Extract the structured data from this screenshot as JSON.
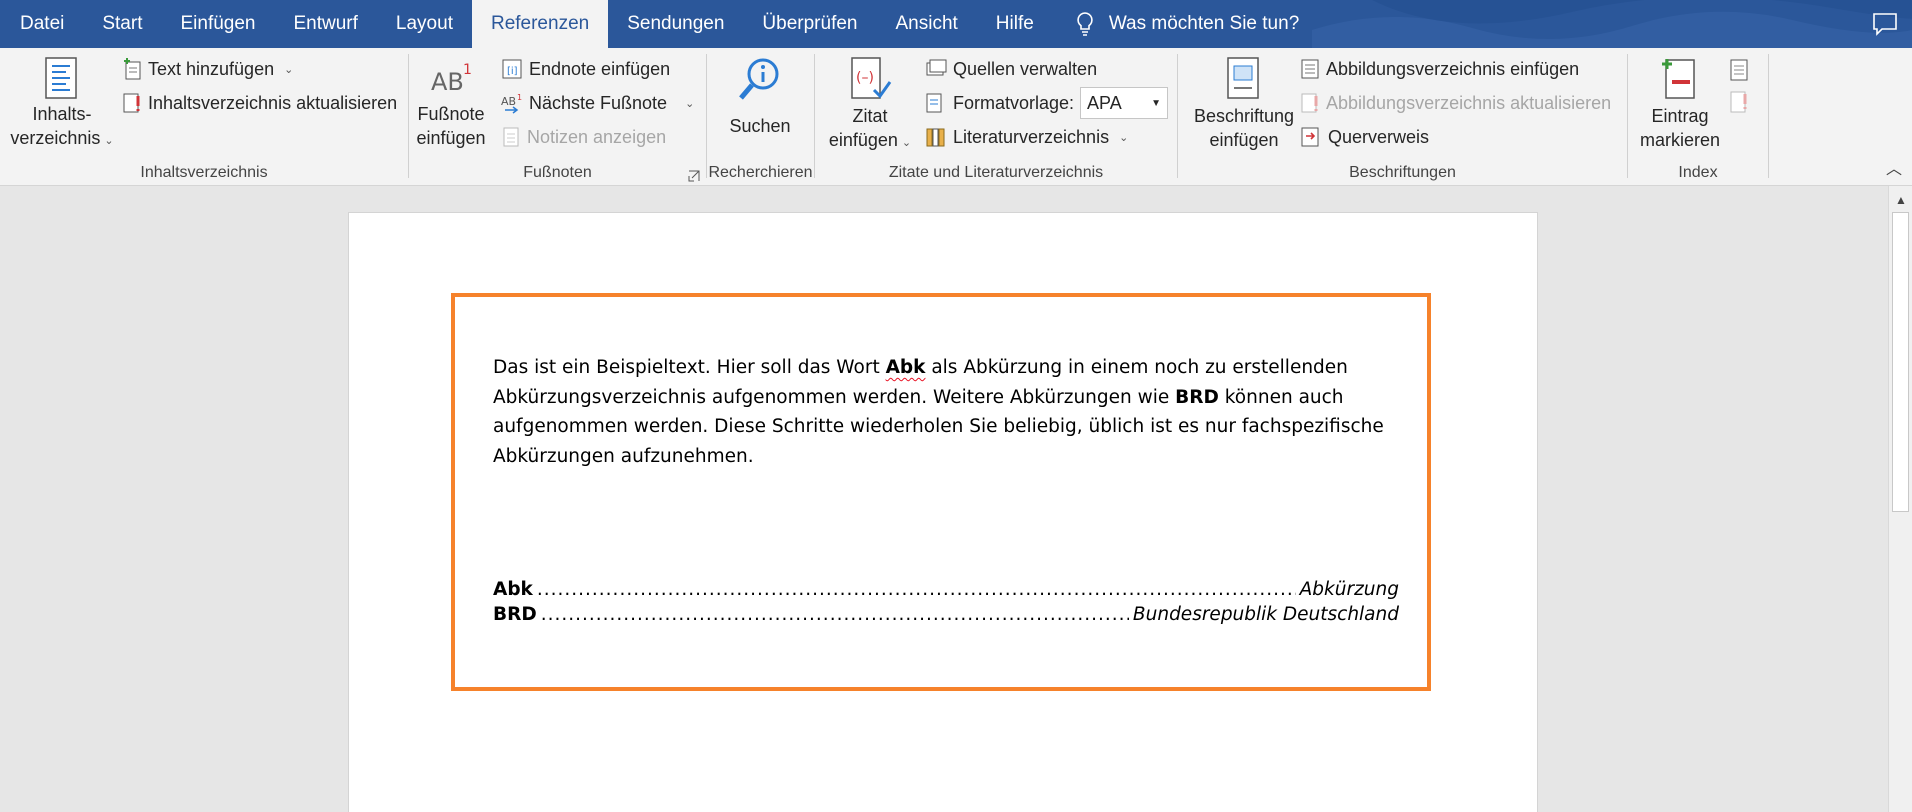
{
  "tabs": [
    "Datei",
    "Start",
    "Einfügen",
    "Entwurf",
    "Layout",
    "Referenzen",
    "Sendungen",
    "Überprüfen",
    "Ansicht",
    "Hilfe"
  ],
  "active_tab": "Referenzen",
  "tell_me": "Was möchten Sie tun?",
  "ribbon": {
    "toc": {
      "group_label": "Inhaltsverzeichnis",
      "toc_button_line1": "Inhalts-",
      "toc_button_line2": "verzeichnis",
      "add_text": "Text hinzufügen",
      "update_toc": "Inhaltsverzeichnis aktualisieren"
    },
    "footnotes": {
      "group_label": "Fußnoten",
      "insert_footnote_line1": "Fußnote",
      "insert_footnote_line2": "einfügen",
      "insert_endnote": "Endnote einfügen",
      "next_footnote": "Nächste Fußnote",
      "show_notes": "Notizen anzeigen"
    },
    "research": {
      "group_label": "Recherchieren",
      "search": "Suchen"
    },
    "citations": {
      "group_label": "Zitate und Literaturverzeichnis",
      "insert_citation_line1": "Zitat",
      "insert_citation_line2": "einfügen",
      "manage_sources": "Quellen verwalten",
      "style_label": "Formatvorlage:",
      "style_value": "APA",
      "bibliography": "Literaturverzeichnis"
    },
    "captions": {
      "group_label": "Beschriftungen",
      "insert_caption_line1": "Beschriftung",
      "insert_caption_line2": "einfügen",
      "insert_tof": "Abbildungsverzeichnis einfügen",
      "update_tof": "Abbildungsverzeichnis aktualisieren",
      "cross_reference": "Querverweis"
    },
    "index": {
      "group_label": "Index",
      "mark_entry_line1": "Eintrag",
      "mark_entry_line2": "markieren"
    }
  },
  "document": {
    "p_part1": "Das ist ein Beispieltext. Hier soll das Wort ",
    "p_bold1": "Abk",
    "p_part2": " als Abkürzung in einem noch zu erstellenden Abkürzungsverzeichnis aufgenommen werden. Weitere Abkürzungen wie ",
    "p_bold2": "BRD",
    "p_part3": " können auch aufgenommen werden. Diese Schritte wiederholen Sie beliebig, üblich ist es nur fachspezifische Abkürzungen aufzunehmen.",
    "entries": [
      {
        "term": "Abk",
        "definition": "Abkürzung"
      },
      {
        "term": "BRD",
        "definition": "Bundesrepublik Deutschland"
      }
    ]
  },
  "colors": {
    "tab_bar": "#2b579a",
    "highlight_frame": "#f6822b"
  }
}
